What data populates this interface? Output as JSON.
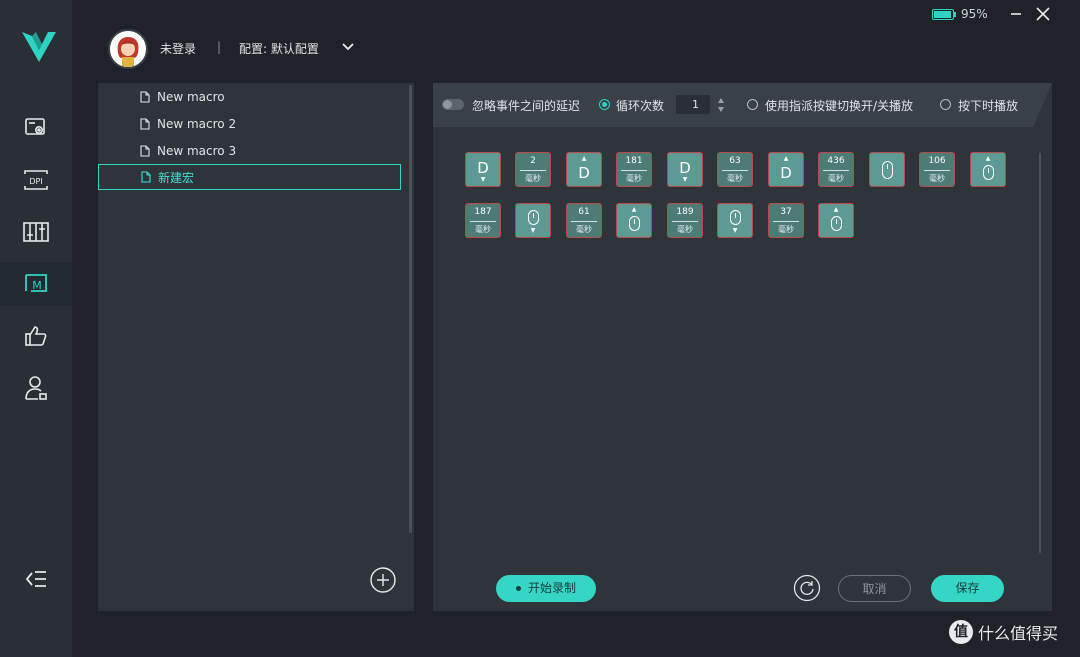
{
  "app": {
    "brand_color": "#2fd3c4",
    "battery": {
      "level_percent": 95,
      "label": "95%"
    }
  },
  "header": {
    "user_status": "未登录",
    "separator": "|",
    "profile_label": "配置: 默认配置"
  },
  "sidebar": {
    "items": [
      {
        "name": "device-settings",
        "icon": "monitor-gear-icon"
      },
      {
        "name": "dpi",
        "icon": "dpi-icon",
        "label": "DPI"
      },
      {
        "name": "keys",
        "icon": "keys-icon"
      },
      {
        "name": "macro",
        "icon": "macro-icon",
        "label": "M",
        "active": true
      },
      {
        "name": "like",
        "icon": "thumbs-up-icon"
      },
      {
        "name": "account",
        "icon": "user-icon"
      }
    ]
  },
  "macro_list": {
    "items": [
      "New macro",
      "New macro 2",
      "New macro 3",
      "新建宏"
    ],
    "selected_index": 3
  },
  "options": {
    "ignore_delay_label": "忽略事件之间的延迟",
    "ignore_delay_on": false,
    "loop_label": "循环次数",
    "loop_count": "1",
    "toggle_label": "使用指派按键切换开/关播放",
    "hold_label": "按下时播放",
    "selected_mode": "loop"
  },
  "events": {
    "delay_unit": "毫秒",
    "row1": [
      {
        "type": "key-down",
        "key": "D"
      },
      {
        "type": "delay",
        "ms": "2"
      },
      {
        "type": "key-up",
        "key": "D"
      },
      {
        "type": "delay",
        "ms": "181"
      },
      {
        "type": "key-down",
        "key": "D"
      },
      {
        "type": "delay",
        "ms": "63"
      },
      {
        "type": "key-up",
        "key": "D"
      },
      {
        "type": "delay",
        "ms": "436"
      },
      {
        "type": "mouse-down"
      },
      {
        "type": "delay",
        "ms": "106"
      },
      {
        "type": "mouse-up"
      }
    ],
    "row2": [
      {
        "type": "delay",
        "ms": "187"
      },
      {
        "type": "mouse-down"
      },
      {
        "type": "delay",
        "ms": "61"
      },
      {
        "type": "mouse-up"
      },
      {
        "type": "delay",
        "ms": "189"
      },
      {
        "type": "mouse-down"
      },
      {
        "type": "delay",
        "ms": "37"
      },
      {
        "type": "mouse-up"
      }
    ]
  },
  "footer": {
    "record_label": "开始录制",
    "cancel_label": "取消",
    "save_label": "保存"
  },
  "watermark": {
    "mark": "值",
    "text": "什么值得买"
  }
}
